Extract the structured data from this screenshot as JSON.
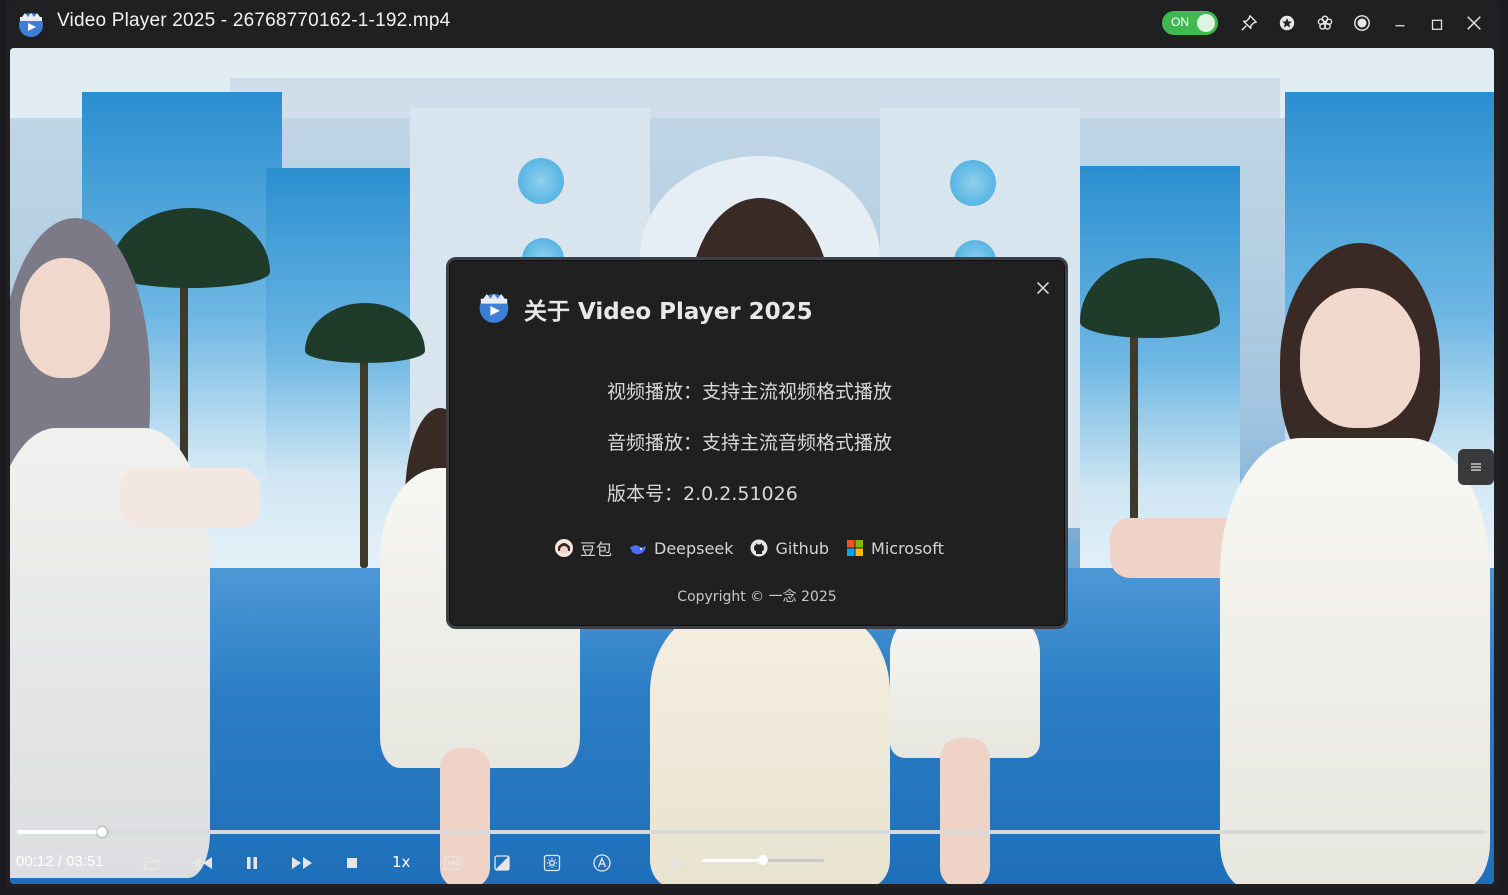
{
  "window": {
    "title": "Video Player 2025 - 26768770162-1-192.mp4",
    "toggle_label": "ON",
    "toggle_color": "#3fb950",
    "title_buttons": [
      "pin-icon",
      "star-icon",
      "flower-icon",
      "record-icon",
      "minimize-icon",
      "maximize-icon",
      "close-icon"
    ]
  },
  "about_dialog": {
    "title": "关于 Video Player 2025",
    "lines": [
      "视频播放：支持主流视频格式播放",
      "音频播放：支持主流音频格式播放",
      "版本号：2.0.2.51026"
    ],
    "links": [
      {
        "label": "豆包",
        "icon": "doubao-icon"
      },
      {
        "label": "Deepseek",
        "icon": "deepseek-icon"
      },
      {
        "label": "Github",
        "icon": "github-icon"
      },
      {
        "label": "Microsoft",
        "icon": "microsoft-icon"
      }
    ],
    "copyright": "Copyright © 一念 2025"
  },
  "player": {
    "current_time": "00:12",
    "separator": "/",
    "total_time": "03:51",
    "progress_fraction": 0.058,
    "speed": "1x",
    "volume_fraction": 0.5,
    "controls": [
      "open-folder-icon",
      "rewind-icon",
      "pause-icon",
      "fast-forward-icon",
      "stop-icon",
      "skip-next-icon",
      "picture-adjust-icon",
      "settings-icon",
      "subtitle-icon",
      "mute-icon",
      "fullscreen-icon"
    ]
  },
  "colors": {
    "accent": "#3fb950",
    "dialog_bg": "#202020",
    "titlebar_bg": "#202022"
  }
}
